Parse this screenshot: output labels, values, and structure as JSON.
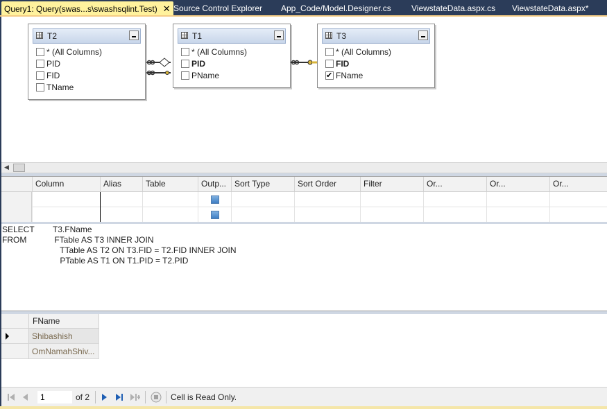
{
  "tabs": [
    {
      "label": "Query1: Query(swas...s\\swashsqlint.Test)",
      "active": true,
      "close": "✕"
    },
    {
      "label": "Source Control Explorer"
    },
    {
      "label": "App_Code/Model.Designer.cs"
    },
    {
      "label": "ViewstateData.aspx.cs"
    },
    {
      "label": "ViewstateData.aspx*"
    }
  ],
  "diagram": {
    "tables": [
      {
        "name": "T2",
        "rows": [
          {
            "label": "* (All Columns)",
            "checked": false,
            "bold": false
          },
          {
            "label": "PID",
            "checked": false,
            "bold": false
          },
          {
            "label": "FID",
            "checked": false,
            "bold": false
          },
          {
            "label": "TName",
            "checked": false,
            "bold": false
          }
        ]
      },
      {
        "name": "T1",
        "rows": [
          {
            "label": "* (All Columns)",
            "checked": false,
            "bold": false
          },
          {
            "label": "PID",
            "checked": false,
            "bold": true
          },
          {
            "label": "PName",
            "checked": false,
            "bold": false
          }
        ]
      },
      {
        "name": "T3",
        "rows": [
          {
            "label": "* (All Columns)",
            "checked": false,
            "bold": false
          },
          {
            "label": "FID",
            "checked": false,
            "bold": true
          },
          {
            "label": "FName",
            "checked": true,
            "bold": false
          }
        ]
      }
    ]
  },
  "criteria": {
    "headers": [
      "Column",
      "Alias",
      "Table",
      "Outp...",
      "Sort Type",
      "Sort Order",
      "Filter",
      "Or...",
      "Or...",
      "Or..."
    ],
    "rows": [
      {
        "output": true
      },
      {
        "output": true
      }
    ]
  },
  "sql": {
    "lines": [
      "SELECT        T3.FName",
      "FROM            FTable AS T3 INNER JOIN",
      "                         TTable AS T2 ON T3.FID = T2.FID INNER JOIN",
      "                         PTable AS T1 ON T1.PID = T2.PID"
    ]
  },
  "results": {
    "column": "FName",
    "rows": [
      "Shibashish",
      "OmNamahShiv..."
    ]
  },
  "navigator": {
    "current_record": "1",
    "of_label": "of 2",
    "status": "Cell is Read Only."
  }
}
